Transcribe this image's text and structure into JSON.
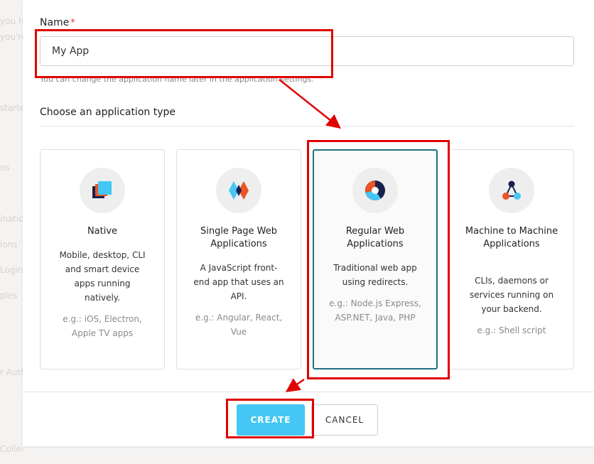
{
  "background": {
    "fragments": [
      "you h",
      "you're",
      "started",
      "ns",
      "inations",
      "ions",
      "Login",
      "ples",
      "r Auth",
      "Collection"
    ]
  },
  "form": {
    "name_label": "Name",
    "required_marker": "*",
    "name_value": "My App",
    "helper_text": "You can change the application name later in the application settings.",
    "section_title": "Choose an application type"
  },
  "cards": [
    {
      "title": "Native",
      "description": "Mobile, desktop, CLI and smart device apps running natively.",
      "example": "e.g.: iOS, Electron, Apple TV apps"
    },
    {
      "title": "Single Page Web Applications",
      "description": "A JavaScript front-end app that uses an API.",
      "example": "e.g.: Angular, React, Vue"
    },
    {
      "title": "Regular Web Applications",
      "description": "Traditional web app using redirects.",
      "example": "e.g.: Node.js Express, ASP.NET, Java, PHP",
      "selected": true
    },
    {
      "title": "Machine to Machine Applications",
      "description": "CLIs, daemons or services running on your backend.",
      "example": "e.g.: Shell script"
    }
  ],
  "footer": {
    "create_label": "CREATE",
    "cancel_label": "CANCEL"
  },
  "colors": {
    "accent": "#44c7f4",
    "selected_border": "#1f6f80",
    "annotation": "#e00000"
  }
}
